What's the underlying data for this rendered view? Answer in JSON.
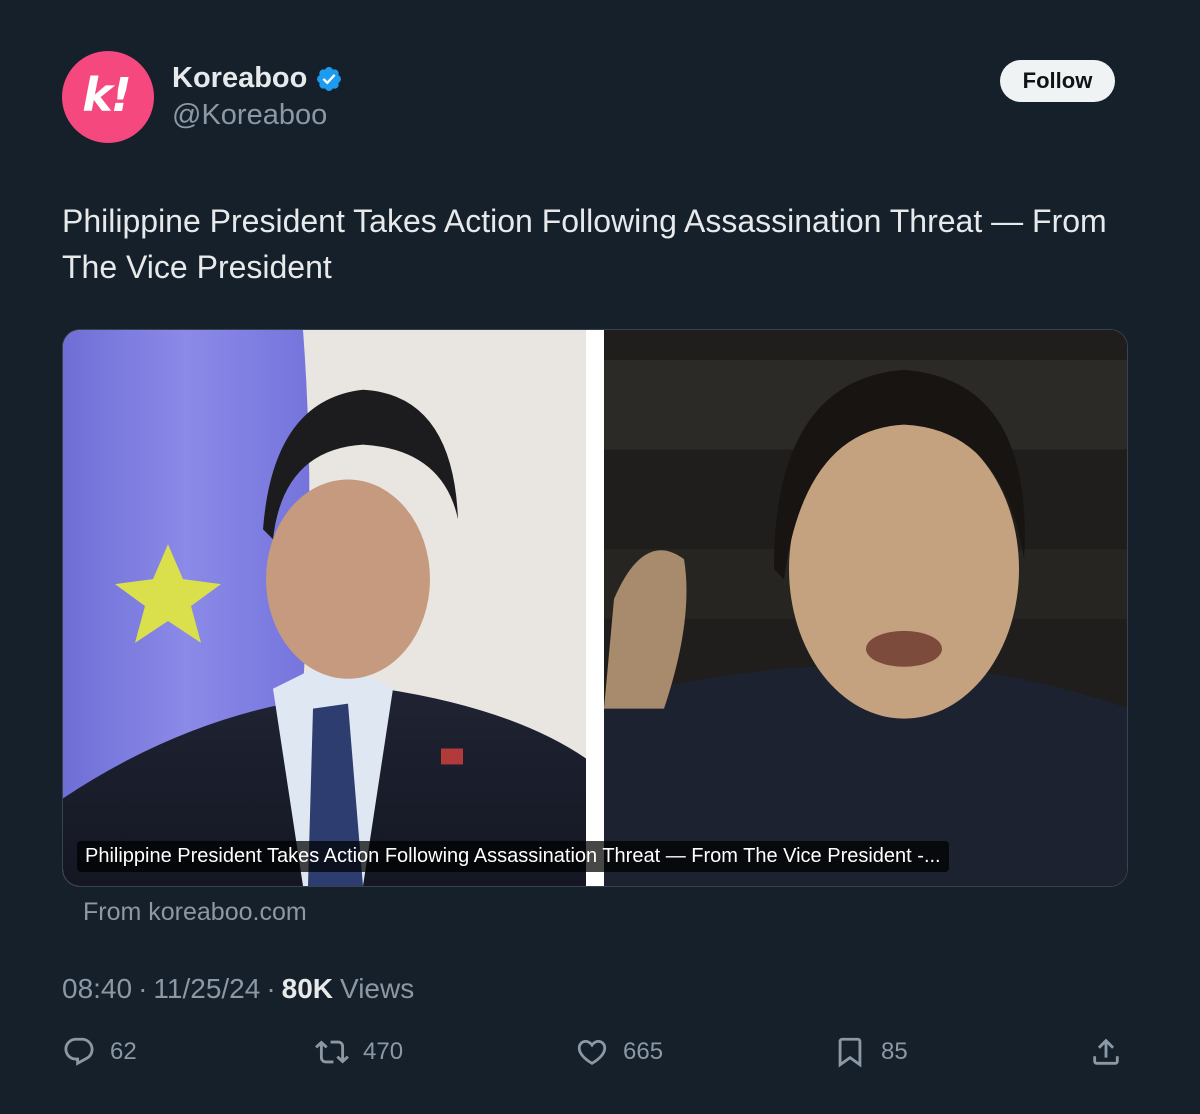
{
  "author": {
    "display_name": "Koreaboo",
    "handle": "@Koreaboo",
    "avatar_letter": "k!",
    "avatar_color": "#f5487f",
    "verified": true
  },
  "follow_label": "Follow",
  "tweet_text": "Philippine President Takes Action Following Assassination Threat — From The Vice President",
  "card": {
    "caption": "Philippine President Takes Action Following Assassination Threat — From The Vice President -...",
    "source": "From koreaboo.com"
  },
  "meta": {
    "time": "08:40",
    "date": "11/25/24",
    "views_count": "80K",
    "views_label": "Views"
  },
  "actions": {
    "replies": "62",
    "retweets": "470",
    "likes": "665",
    "bookmarks": "85"
  },
  "colors": {
    "background": "#15202b",
    "secondary_text": "#8b98a5",
    "verified_badge": "#1d9bf0"
  }
}
